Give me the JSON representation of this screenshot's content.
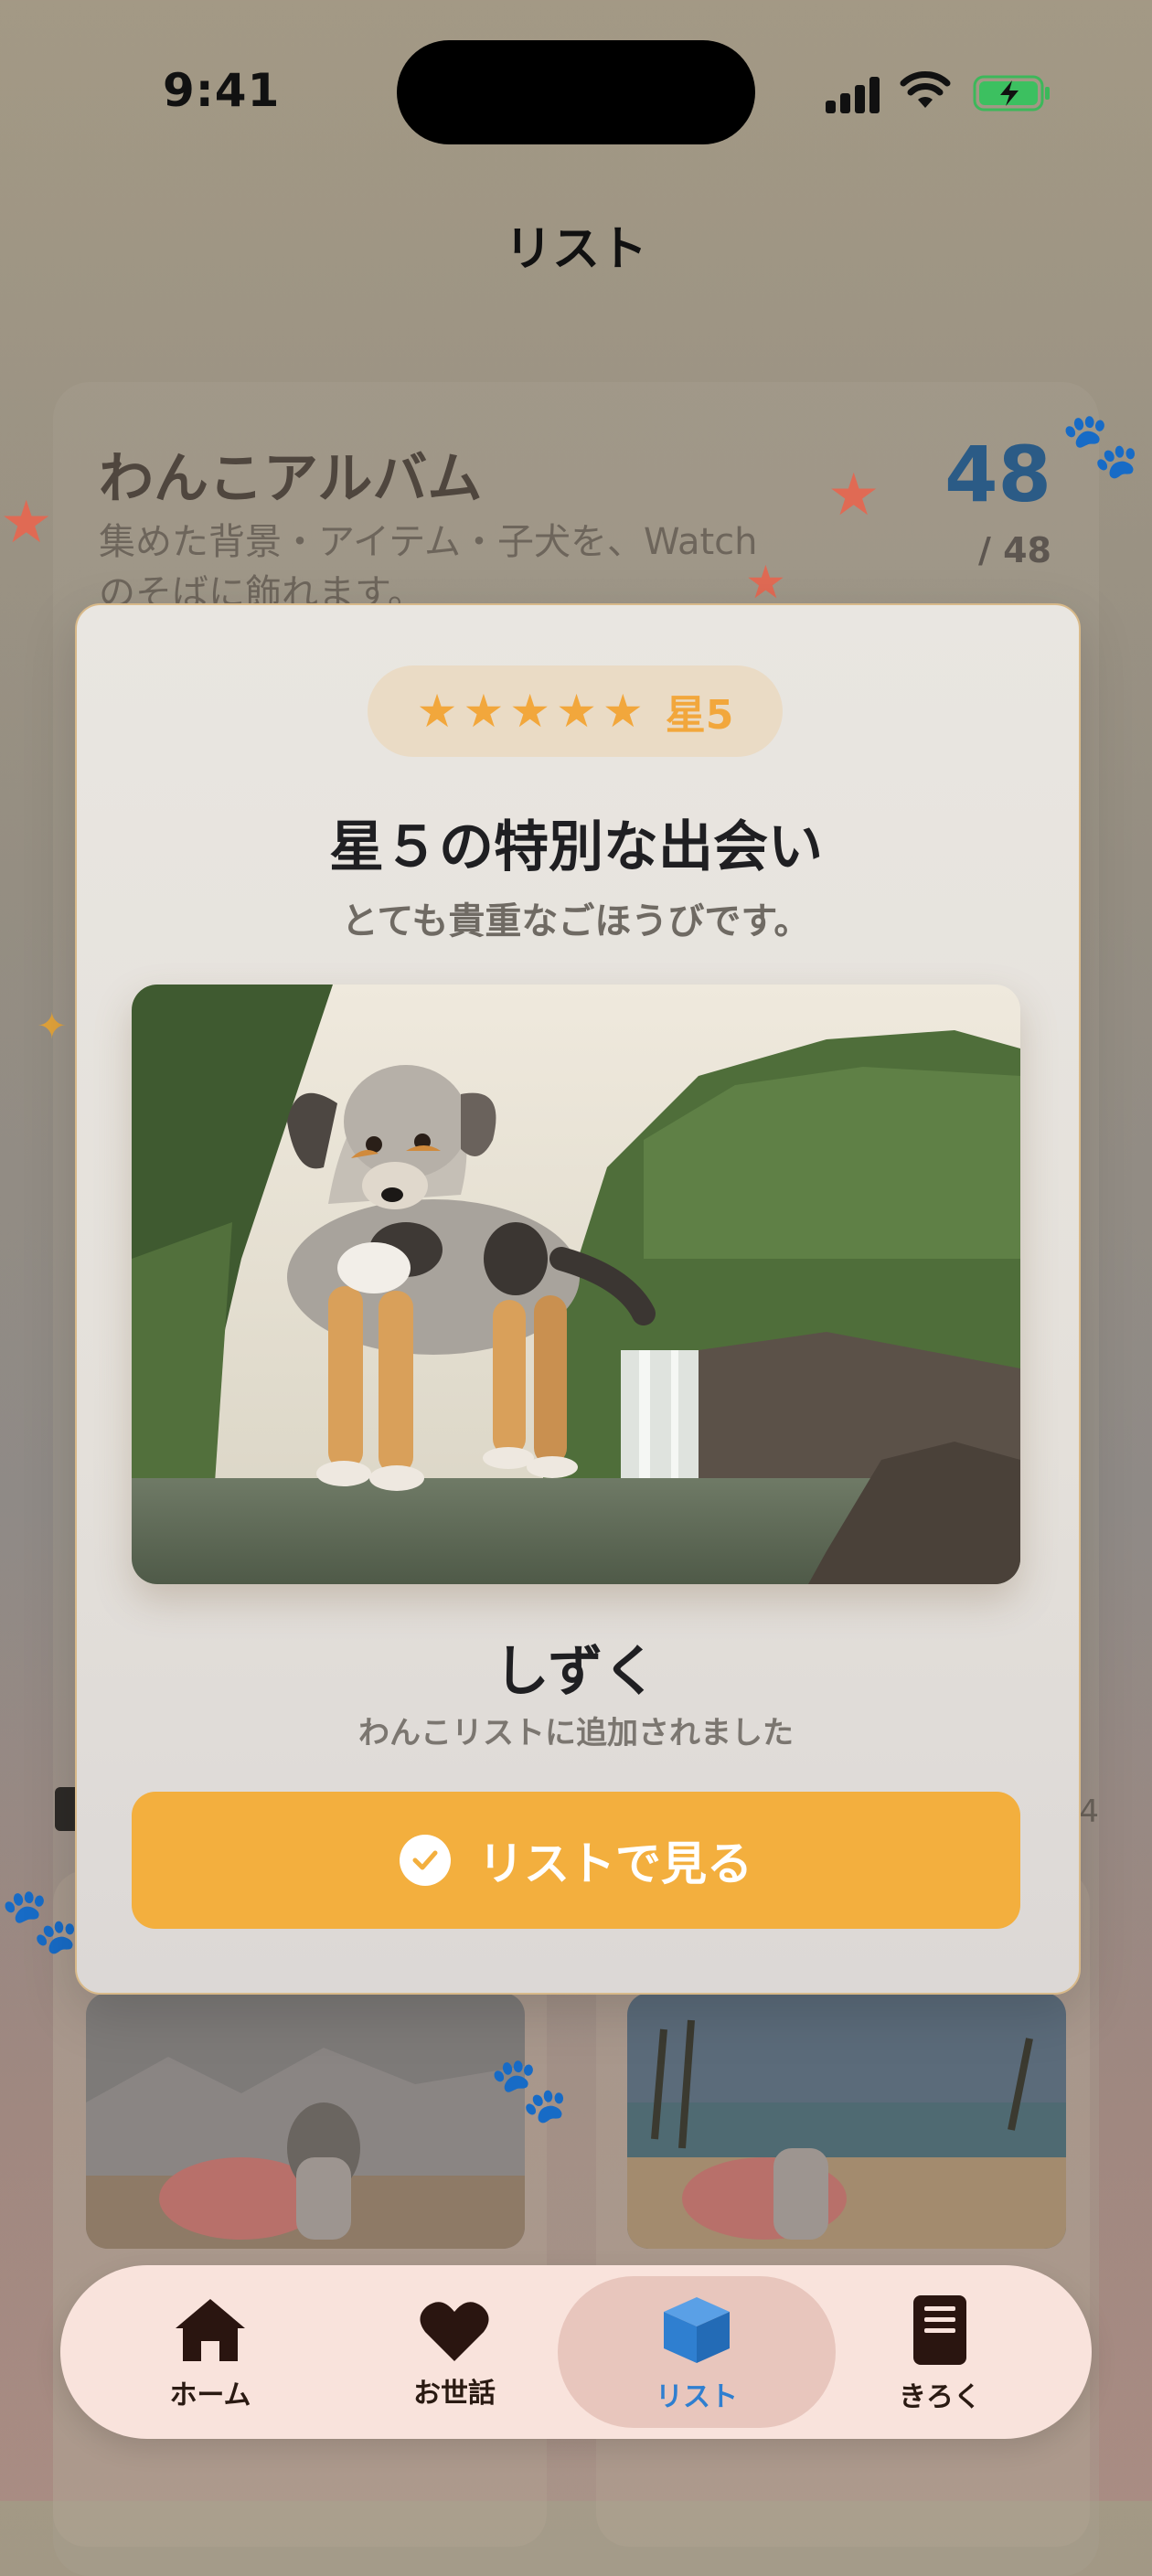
{
  "status_bar": {
    "time": "9:41"
  },
  "nav": {
    "title": "リスト"
  },
  "album": {
    "title": "わんこアルバム",
    "subtitle_line1": "集めた背景・アイテム・子犬を、Watch",
    "subtitle_line2": "のそばに飾れます。",
    "count": "48",
    "total": "/ 48",
    "side_count": "4"
  },
  "modal": {
    "rating_label": "星5",
    "stars": 5,
    "heading": "星５の特別な出会い",
    "subheading": "とても貴重なごほうびです。",
    "dog_name": "しずく",
    "message": "わんこリストに追加されました",
    "button_label": "リストで見る"
  },
  "tabs": [
    {
      "label": "ホーム",
      "icon": "house-icon",
      "active": false
    },
    {
      "label": "お世話",
      "icon": "heart-icon",
      "active": false
    },
    {
      "label": "リスト",
      "icon": "box-icon",
      "active": true
    },
    {
      "label": "きろく",
      "icon": "book-icon",
      "active": false
    }
  ],
  "colors": {
    "accent": "#f3af3e",
    "star": "#f2a73c",
    "count_blue": "#2b5b86",
    "tab_active": "#2f7fd0",
    "tabbar_bg": "#f9e3dc"
  }
}
